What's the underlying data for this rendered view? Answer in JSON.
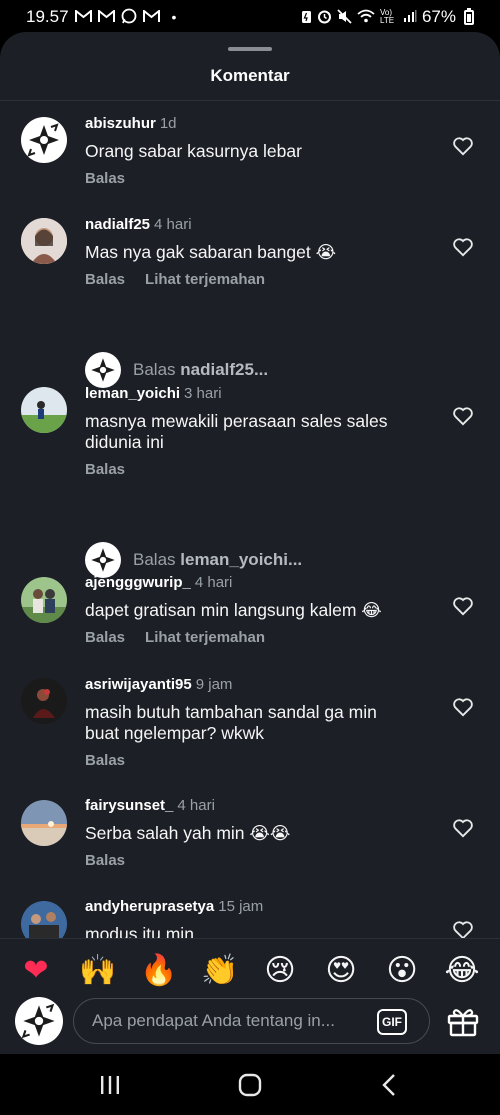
{
  "status_bar": {
    "time": "19.57",
    "notif_icons": [
      "gmail-icon",
      "gmail-icon",
      "whatsapp-icon",
      "gmail-icon"
    ],
    "dot": "•",
    "network": "Vo) LTE",
    "battery": "67%"
  },
  "sheet": {
    "title": "Komentar"
  },
  "comments": [
    {
      "username": "abiszuhur",
      "time": "1d",
      "text": "Orang sabar kasurnya lebar",
      "actions": [
        "Balas"
      ],
      "avatar": "ninja-star-avatar"
    },
    {
      "username": "nadialf25",
      "time": "4 hari",
      "text": "Mas nya gak sabaran banget 😭",
      "actions": [
        "Balas",
        "Lihat terjemahan"
      ],
      "avatar": "photo-avatar"
    },
    {
      "username": "leman_yoichi",
      "time": "3 hari",
      "text": "masnya mewakili perasaan sales sales didunia ini",
      "actions": [
        "Balas"
      ],
      "avatar": "photo-avatar"
    },
    {
      "username": "ajengggwurip_",
      "time": "4 hari",
      "text": "dapet gratisan min langsung kalem 😂",
      "actions": [
        "Balas",
        "Lihat terjemahan"
      ],
      "avatar": "photo-avatar"
    },
    {
      "username": "asriwijayanti95",
      "time": "9 jam",
      "text": "masih butuh tambahan sandal ga min buat ngelempar? wkwk",
      "actions": [
        "Balas"
      ],
      "avatar": "photo-avatar"
    },
    {
      "username": "fairysunset_",
      "time": "4 hari",
      "text": "Serba salah yah min 😭😭",
      "actions": [
        "Balas"
      ],
      "avatar": "photo-avatar"
    },
    {
      "username": "andyheruprasetya",
      "time": "15 jam",
      "text": "modus itu min",
      "actions": [],
      "avatar": "photo-avatar"
    }
  ],
  "replies": [
    {
      "prefix": "Balas",
      "target": "nadialf25..."
    },
    {
      "prefix": "Balas",
      "target": "leman_yoichi..."
    }
  ],
  "emoji_bar": [
    "❤",
    "🙌",
    "🔥",
    "👏",
    "😢",
    "😍",
    "😮",
    "😂"
  ],
  "composer": {
    "placeholder": "Apa pendapat Anda tentang in...",
    "gif_label": "GIF"
  },
  "colors": {
    "sheet_bg": "#1c1f26",
    "text_secondary": "#9aa0a8",
    "heart_emoji": "#ff2d55"
  }
}
